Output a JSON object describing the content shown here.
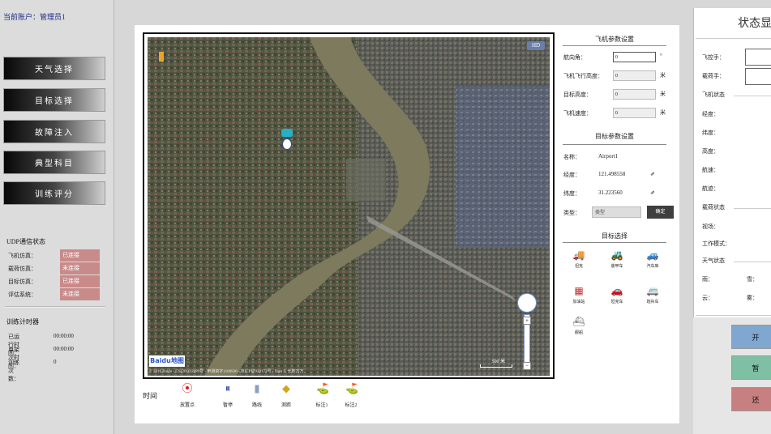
{
  "user": {
    "label": "当前账户：管理员1"
  },
  "nav": [
    {
      "label": "天气选择"
    },
    {
      "label": "目标选择"
    },
    {
      "label": "故障注入"
    },
    {
      "label": "典型科目"
    },
    {
      "label": "训练评分"
    }
  ],
  "udp": {
    "title": "UDP通信状态",
    "rows": [
      {
        "k": "飞机仿真：",
        "v": "已连接"
      },
      {
        "k": "载荷仿真：",
        "v": "未连接"
      },
      {
        "k": "目标仿真：",
        "v": "已连接"
      },
      {
        "k": "评估系统：",
        "v": "未连接"
      }
    ]
  },
  "timer": {
    "title": "训练计时器",
    "rows": [
      {
        "k": "已运行时间：",
        "v": "00:00:00"
      },
      {
        "k": "单架次时间：",
        "v": "00:00:00"
      },
      {
        "k": "训练次数：",
        "v": "0"
      }
    ]
  },
  "map": {
    "badge": "HD",
    "logo": "Baidu地图",
    "scale": "500 米",
    "attribution": "© 2016 Baidu - GS(2016)2089号 - 甲测资字1100930 - 京ICP证030173号 - Data © 长地万方"
  },
  "toolbar": {
    "label": "时间",
    "tools": [
      {
        "label": "放置点",
        "icon": "⦿",
        "color": "#d22"
      },
      {
        "label": "暂停",
        "icon": "⏸",
        "color": "#2b4a9c"
      },
      {
        "label": "路线",
        "icon": "▮",
        "color": "#8aa0c0"
      },
      {
        "label": "测距",
        "icon": "◆",
        "color": "#d6a521"
      },
      {
        "label": "标注1",
        "icon": "⛳",
        "color": "#c33"
      },
      {
        "label": "标注2",
        "icon": "⛳",
        "color": "#c33"
      }
    ]
  },
  "flight": {
    "title": "飞机参数设置",
    "rows": [
      {
        "k": "航向角：",
        "v": "0",
        "u": "°"
      },
      {
        "k": "飞机飞行高度：",
        "v": "0",
        "u": "米"
      },
      {
        "k": "目标高度：",
        "v": "0",
        "u": "米"
      },
      {
        "k": "飞机速度：",
        "v": "0",
        "u": "米"
      }
    ]
  },
  "target": {
    "title": "目标参数设置",
    "name_label": "名称：",
    "name_value": "Airport1",
    "lng_label": "经度：",
    "lng_value": "121.498558",
    "lat_label": "纬度：",
    "lat_value": "31.223560",
    "arrow": "⇗",
    "type_label": "类型：",
    "type_placeholder": "类型",
    "confirm": "确定",
    "select_title": "目标选择",
    "items": [
      {
        "label": "坦克",
        "icon": "🚚",
        "color": "#8a7a4a"
      },
      {
        "label": "装甲车",
        "icon": "🚜",
        "color": "#6a6a3a"
      },
      {
        "label": "汽车库",
        "icon": "🚙",
        "color": "#777"
      },
      {
        "label": "加油站",
        "icon": "▦",
        "color": "#b33"
      },
      {
        "label": "坦克车",
        "icon": "🚗",
        "color": "#2a8a8a"
      },
      {
        "label": "炮兵车",
        "icon": "🚐",
        "color": "#c9a21c"
      },
      {
        "label": "舰船",
        "icon": "⛴",
        "color": "#7a7a7a"
      }
    ]
  },
  "status": {
    "title": "状态显示",
    "plane_id_label": "飞控手：",
    "payload_id_label": "载荷手：",
    "plane_state": "飞机状态",
    "rows_plane": [
      {
        "k": "经度："
      },
      {
        "k": "纬度："
      },
      {
        "k": "高度："
      },
      {
        "k": "航速："
      },
      {
        "k": "航迹："
      }
    ],
    "payload_state": "载荷状态",
    "rows_payload": [
      {
        "k": "视场："
      },
      {
        "k": "工作模式："
      }
    ],
    "weather_state": "天气状态",
    "weather_row1_a": "雨：",
    "weather_row1_b": "雪：",
    "weather_row2_a": "云：",
    "weather_row2_b": "雾：",
    "buttons": [
      {
        "label": "开",
        "color": "#7fa7cf"
      },
      {
        "label": "暂",
        "color": "#7fc0a5"
      },
      {
        "label": "还",
        "color": "#c77f7f"
      }
    ]
  }
}
